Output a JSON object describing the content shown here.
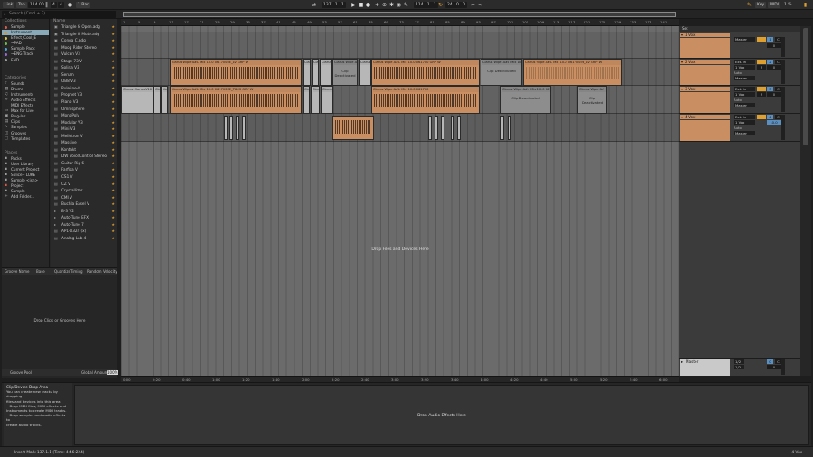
{
  "transport": {
    "link": "Link",
    "tap": "Tap",
    "tempo": "114.00",
    "sig_num": "4",
    "sig_den": "4",
    "metro_label": "1 Bar",
    "position": "137 .  1 .  1",
    "loop_start": "114 .  1 .  1",
    "loop_len": "24 .  0 .  0",
    "key": "Key",
    "midi": "MIDI",
    "cpu": "1 %"
  },
  "search": {
    "placeholder": "Search (Cmd + F)"
  },
  "browser": {
    "collections_header": "Collections",
    "collections": [
      {
        "label": "Sample",
        "color": "#e05a4a"
      },
      {
        "label": "Instrument",
        "color": "#e0902a",
        "selected": true
      },
      {
        "label": "Effect_Cool_E",
        "color": "#d4c240"
      },
      {
        "label": "~PAD",
        "color": "#6cc04a"
      },
      {
        "label": "Sample Pack",
        "color": "#4aa6d8"
      },
      {
        "label": "~ENG Track",
        "color": "#9a6ad8"
      },
      {
        "label": "END",
        "color": "#9a9a9a"
      }
    ],
    "categories_header": "Categories",
    "categories": [
      "Sounds",
      "Drums",
      "Instruments",
      "Audio Effects",
      "MIDI Effects",
      "Max for Live",
      "Plug-Ins",
      "Clips",
      "Samples",
      "Grooves",
      "Templates"
    ],
    "places_header": "Places",
    "places": [
      "Packs",
      "User Library",
      "Current Project",
      "Splice - LUKE",
      "Sample <ish>",
      "Project",
      "Sample",
      "Add Folder..."
    ],
    "name_header": "Name",
    "items": [
      "Triangle G Open.adg",
      "Triangle G Mute.adg",
      "Conga C.adg",
      "Moog Rider Stereo",
      "Vulcan V3",
      "Stage 73 V",
      "Solina V3",
      "Serum",
      "OB8 V3",
      "Ruleline-8",
      "Prophet V3",
      "Piano V3",
      "Omnisphere",
      "MonoPoly",
      "Modular V3",
      "Mini V3",
      "Mellotron V",
      "Massive",
      "Kontakt",
      "DW VoiceControl Stereo",
      "Guitar Rig 6",
      "Farfisa V",
      "CS1 V",
      "CZ V",
      "Crystallizer",
      "CMI V",
      "Buchla Easel V",
      "B-3 V2",
      "Auto-Tune EFX",
      "Auto-Tune 7",
      "AP1-0324 (x)",
      "Analog Lab 4"
    ]
  },
  "groove": {
    "cols": [
      "Groove Name",
      "Base",
      "Quantize",
      "Timing",
      "Random",
      "Velocity"
    ],
    "drop": "Drop Clips or Grooves Here",
    "pool": "Groove Pool",
    "global": "Global Amount",
    "pct": "100%"
  },
  "arrangement": {
    "bars": [
      "1",
      "5",
      "9",
      "13",
      "17",
      "21",
      "25",
      "29",
      "33",
      "37",
      "41",
      "45",
      "49",
      "53",
      "57",
      "61",
      "65",
      "69",
      "73",
      "77",
      "81",
      "85",
      "89",
      "93",
      "97",
      "101",
      "105",
      "109",
      "113",
      "117",
      "121",
      "125",
      "129",
      "133",
      "137",
      "141",
      "145"
    ],
    "times": [
      "0:00",
      "0:20",
      "0:40",
      "1:00",
      "1:20",
      "1:40",
      "2:00",
      "2:20",
      "2:40",
      "3:00",
      "3:20",
      "3:40",
      "4:00",
      "4:20",
      "4:40",
      "5:00",
      "5:20",
      "5:40",
      "6:00"
    ],
    "drop": "Drop Files and Devices Here",
    "clip_title_a": "Clarus Wipe A#L Mix 10.0 06170S9E_LV GRP W",
    "clip_title_b": "Clarus Wipe A#L Mix 10.0 06170S9E_T8CS GRP W",
    "clip_title_c": "Clarus Wipe A#L Mix 10.0 061700",
    "clip_title_d": "Clarus Wipe A#L Mix 10.0 061700 GRP W",
    "clip_title_e": "Clarus Wipe A#L Mix 10.0 06170S9E_LV GRP W",
    "clip_title_f": "Clarus Clarus V10",
    "clip_title_g": "Clarus Wipe A#L Mix 10.0 061700",
    "clip_title_h": "Clarus Wipe A#L Mix 10.0 061700",
    "small_a": "Clar",
    "small_b": "Clar",
    "small_c": "Clarus",
    "small_d": "Clarus Wipe A#",
    "small_e": "Clarus",
    "small_f": "Clarus W",
    "deact": "Clip Deactivated",
    "deact2": "Clip Deactivated",
    "deact3": "Clip Deactivated",
    "deact4": "Clip Deactivated",
    "deact5": "Clip Deactivated"
  },
  "tracks": {
    "set": "Set",
    "master_label": "Master",
    "t1": {
      "name": "1 Vox",
      "out": "Master",
      "num": "1",
      "pan": "C",
      "vol": "0"
    },
    "t2": {
      "name": "2 Vox",
      "in": "Ext. In",
      "in2": "1 Vox",
      "auto": "Auto",
      "out": "Master",
      "num": "2",
      "pan": "C",
      "vol": "0",
      "s": "S",
      "vol2": "0"
    },
    "t3": {
      "name": "3 Vox",
      "in": "Ext. In",
      "in2": "1 Vox",
      "auto": "Auto",
      "out": "Master",
      "num": "3",
      "pan": "C",
      "vol": "0",
      "s": "S",
      "vol2": "0"
    },
    "t4": {
      "name": "4 Vox",
      "in": "Ext. In",
      "in2": "1 Vox",
      "auto": "Auto",
      "out": "Master",
      "num": "4",
      "pan": "C",
      "vol": "-0.0"
    },
    "master": {
      "name": "Master",
      "io1": "1/2",
      "io2": "1/2",
      "num": "0",
      "pan": "C",
      "vol": "0"
    }
  },
  "device": {
    "info_title": "Clip/Device Drop Area",
    "info_lines": [
      "You can create new tracks by dropping",
      "files and devices into this area:",
      "• Drop MIDI files, MIDI effects and",
      "Instruments to create MIDI tracks.",
      "• Drop samples and audio effects to",
      "create audio tracks."
    ],
    "drop": "Drop Audio Effects Here"
  },
  "status": {
    "text": "Insert Mark 137.1.1 (Time: 4:46:224)",
    "track": "4 Vox"
  },
  "colors": {
    "clip": "#c98f62",
    "accent": "#e0a030",
    "selected": "#8aa9b8"
  }
}
